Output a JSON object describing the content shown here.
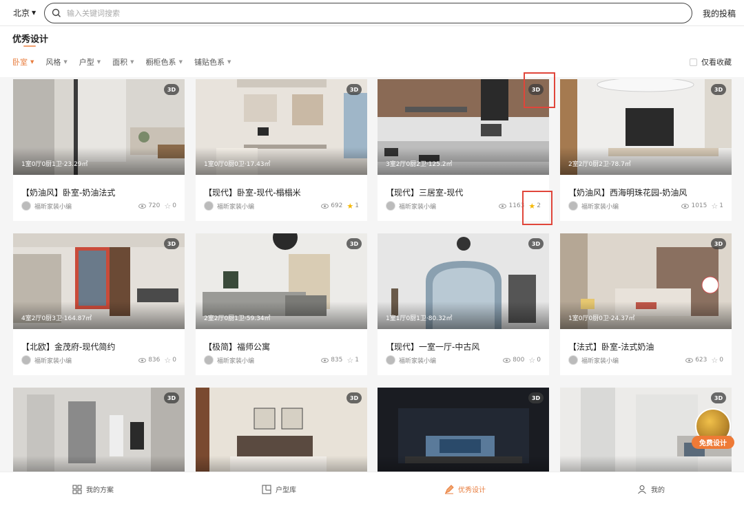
{
  "topbar": {
    "city": "北京",
    "search_placeholder": "输入关键词搜索",
    "my_post": "我的投稿"
  },
  "page_title": "优秀设计",
  "filters": [
    {
      "label": "卧室",
      "active": true
    },
    {
      "label": "风格",
      "active": false
    },
    {
      "label": "户型",
      "active": false
    },
    {
      "label": "面积",
      "active": false
    },
    {
      "label": "橱柜色系",
      "active": false
    },
    {
      "label": "铺贴色系",
      "active": false
    }
  ],
  "fav_only_label": "仅看收藏",
  "badge_label": "3D",
  "cards": [
    {
      "specs": "1室0厅0厨1卫·23.29㎡",
      "title": "【奶油风】卧室-奶油法式",
      "author": "福昕家装小编",
      "views": "720",
      "favs": "0",
      "fav_on": false,
      "scene": "bath"
    },
    {
      "specs": "1室0厅0厨0卫·17.43㎡",
      "title": "【现代】卧室-现代-榻榻米",
      "author": "福昕家装小编",
      "views": "692",
      "favs": "1",
      "fav_on": true,
      "scene": "study"
    },
    {
      "specs": "3室2厅0厨2卫·125.2㎡",
      "title": "【现代】三居室-现代",
      "author": "福昕家装小编",
      "views": "1163",
      "favs": "2",
      "fav_on": true,
      "scene": "kitchen"
    },
    {
      "specs": "2室2厅0厨2卫·78.7㎡",
      "title": "【奶油风】西海明珠花园-奶油风",
      "author": "福昕家装小编",
      "views": "1015",
      "favs": "1",
      "fav_on": false,
      "scene": "living"
    },
    {
      "specs": "4室2厅0厨3卫·164.87㎡",
      "title": "【北欧】金茂府-现代简约",
      "author": "福昕家装小编",
      "views": "836",
      "favs": "0",
      "fav_on": false,
      "scene": "nordic"
    },
    {
      "specs": "2室2厅0厨1卫·59.34㎡",
      "title": "【极简】福师公寓",
      "author": "福昕家装小编",
      "views": "835",
      "favs": "1",
      "fav_on": false,
      "scene": "sofa"
    },
    {
      "specs": "1室1厅0厨1卫·80.32㎡",
      "title": "【现代】一室一厅-中古风",
      "author": "福昕家装小编",
      "views": "800",
      "favs": "0",
      "fav_on": false,
      "scene": "arch"
    },
    {
      "specs": "1室0厅0厨0卫·24.37㎡",
      "title": "【法式】卧室-法式奶油",
      "author": "福昕家装小编",
      "views": "623",
      "favs": "0",
      "fav_on": false,
      "scene": "bedroom"
    },
    {
      "specs": "",
      "title": "",
      "author": "",
      "views": "",
      "favs": "",
      "fav_on": false,
      "scene": "shower"
    },
    {
      "specs": "",
      "title": "",
      "author": "",
      "views": "",
      "favs": "",
      "fav_on": false,
      "scene": "classic"
    },
    {
      "specs": "",
      "title": "",
      "author": "",
      "views": "",
      "favs": "",
      "fav_on": false,
      "scene": "dark"
    },
    {
      "specs": "",
      "title": "",
      "author": "",
      "views": "",
      "favs": "",
      "fav_on": false,
      "scene": "white"
    }
  ],
  "free_design_label": "免费设计",
  "bottom_nav": [
    {
      "label": "我的方案",
      "icon": "grid-icon",
      "active": false
    },
    {
      "label": "户型库",
      "icon": "floorplan-icon",
      "active": false
    },
    {
      "label": "优秀设计",
      "icon": "pen-icon",
      "active": true
    },
    {
      "label": "我的",
      "icon": "user-icon",
      "active": false
    }
  ],
  "colors": {
    "accent": "#e87d3e",
    "highlight": "#e0453a",
    "fav_star": "#f5b800"
  }
}
